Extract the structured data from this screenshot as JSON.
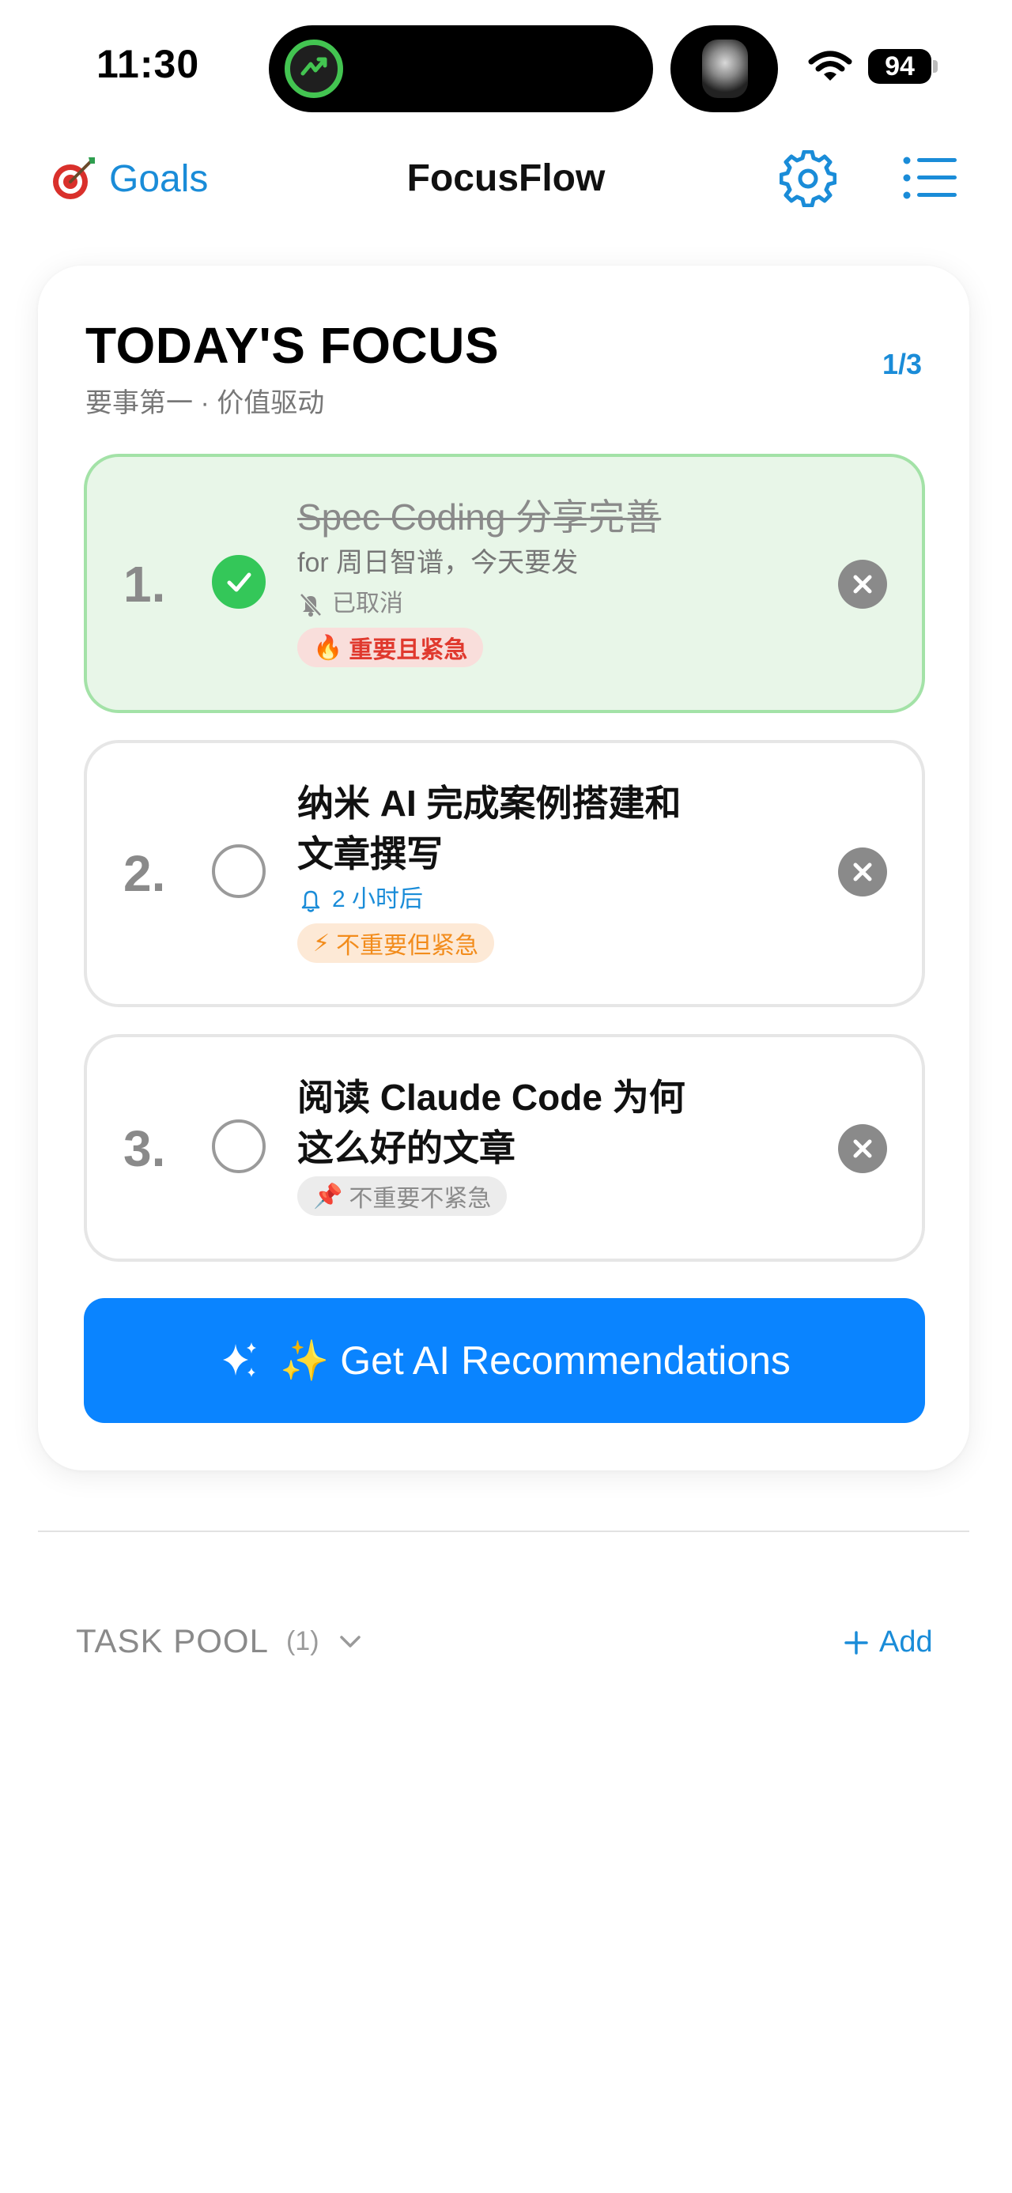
{
  "status_bar": {
    "time": "11:30",
    "battery": "94"
  },
  "header": {
    "goals_label": "Goals",
    "title": "FocusFlow"
  },
  "focus": {
    "title": "TODAY'S FOCUS",
    "subtitle": "要事第一 · 价值驱动",
    "count": "1/3",
    "tasks": [
      {
        "number": "1.",
        "title": "Spec Coding 分享完善",
        "note": "for 周日智谱，今天要发",
        "reminder": "已取消",
        "badge_emoji": "🔥",
        "badge": "重要且紧急",
        "done": true
      },
      {
        "number": "2.",
        "title_line1": "纳米 AI 完成案例搭建和",
        "title_line2": "文章撰写",
        "reminder": "2 小时后",
        "badge_emoji": "⚡",
        "badge": "不重要但紧急",
        "done": false
      },
      {
        "number": "3.",
        "title_line1": "阅读 Claude Code 为何",
        "title_line2": "这么好的文章",
        "badge_emoji": "📌",
        "badge": "不重要不紧急",
        "done": false
      }
    ],
    "ai_button_label": "✨ Get AI Recommendations"
  },
  "task_pool": {
    "title": "TASK POOL",
    "count": "(1)",
    "add_label": "Add"
  },
  "colors": {
    "accent": "#1a8cd8",
    "button_blue": "#0a84ff",
    "done_green": "#34c759",
    "urgent_red": "#e0392e",
    "warning_orange": "#f28c1c"
  }
}
